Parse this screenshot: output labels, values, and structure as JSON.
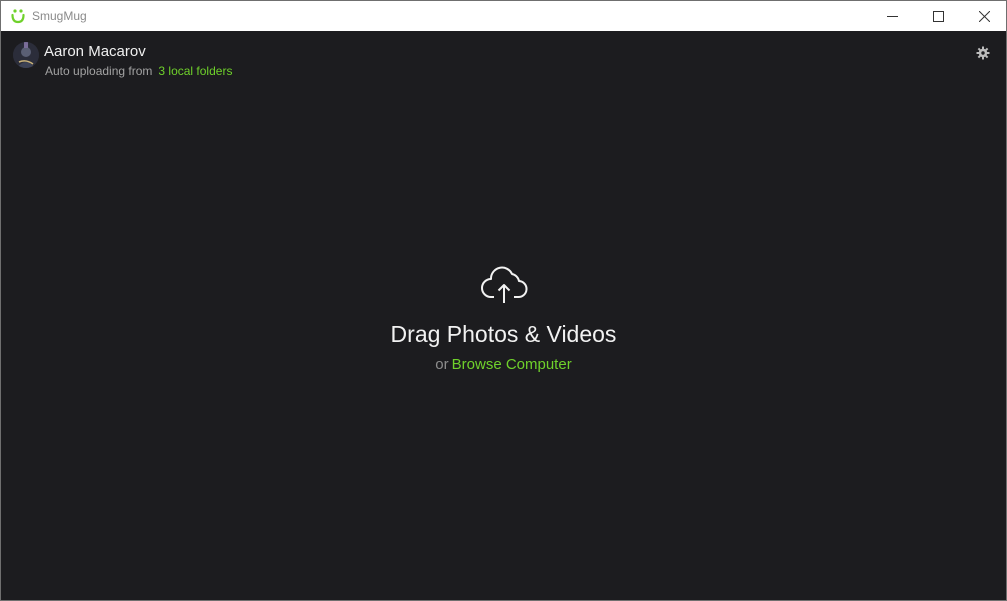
{
  "window": {
    "title": "SmugMug",
    "controls": {
      "minimize": "minimize",
      "maximize": "maximize",
      "close": "close"
    }
  },
  "header": {
    "user_name": "Aaron Macarov",
    "status_prefix": "Auto uploading from",
    "folders_link": "3 local folders"
  },
  "dropzone": {
    "title": "Drag Photos & Videos",
    "or_text": "or",
    "browse_link": "Browse Computer"
  },
  "colors": {
    "accent": "#6fd12b",
    "background": "#1c1c1f",
    "titlebar": "#ffffff"
  },
  "icons": [
    "smugmug-logo-icon",
    "minimize-icon",
    "maximize-icon",
    "close-icon",
    "avatar",
    "gear-icon",
    "cloud-upload-icon"
  ]
}
